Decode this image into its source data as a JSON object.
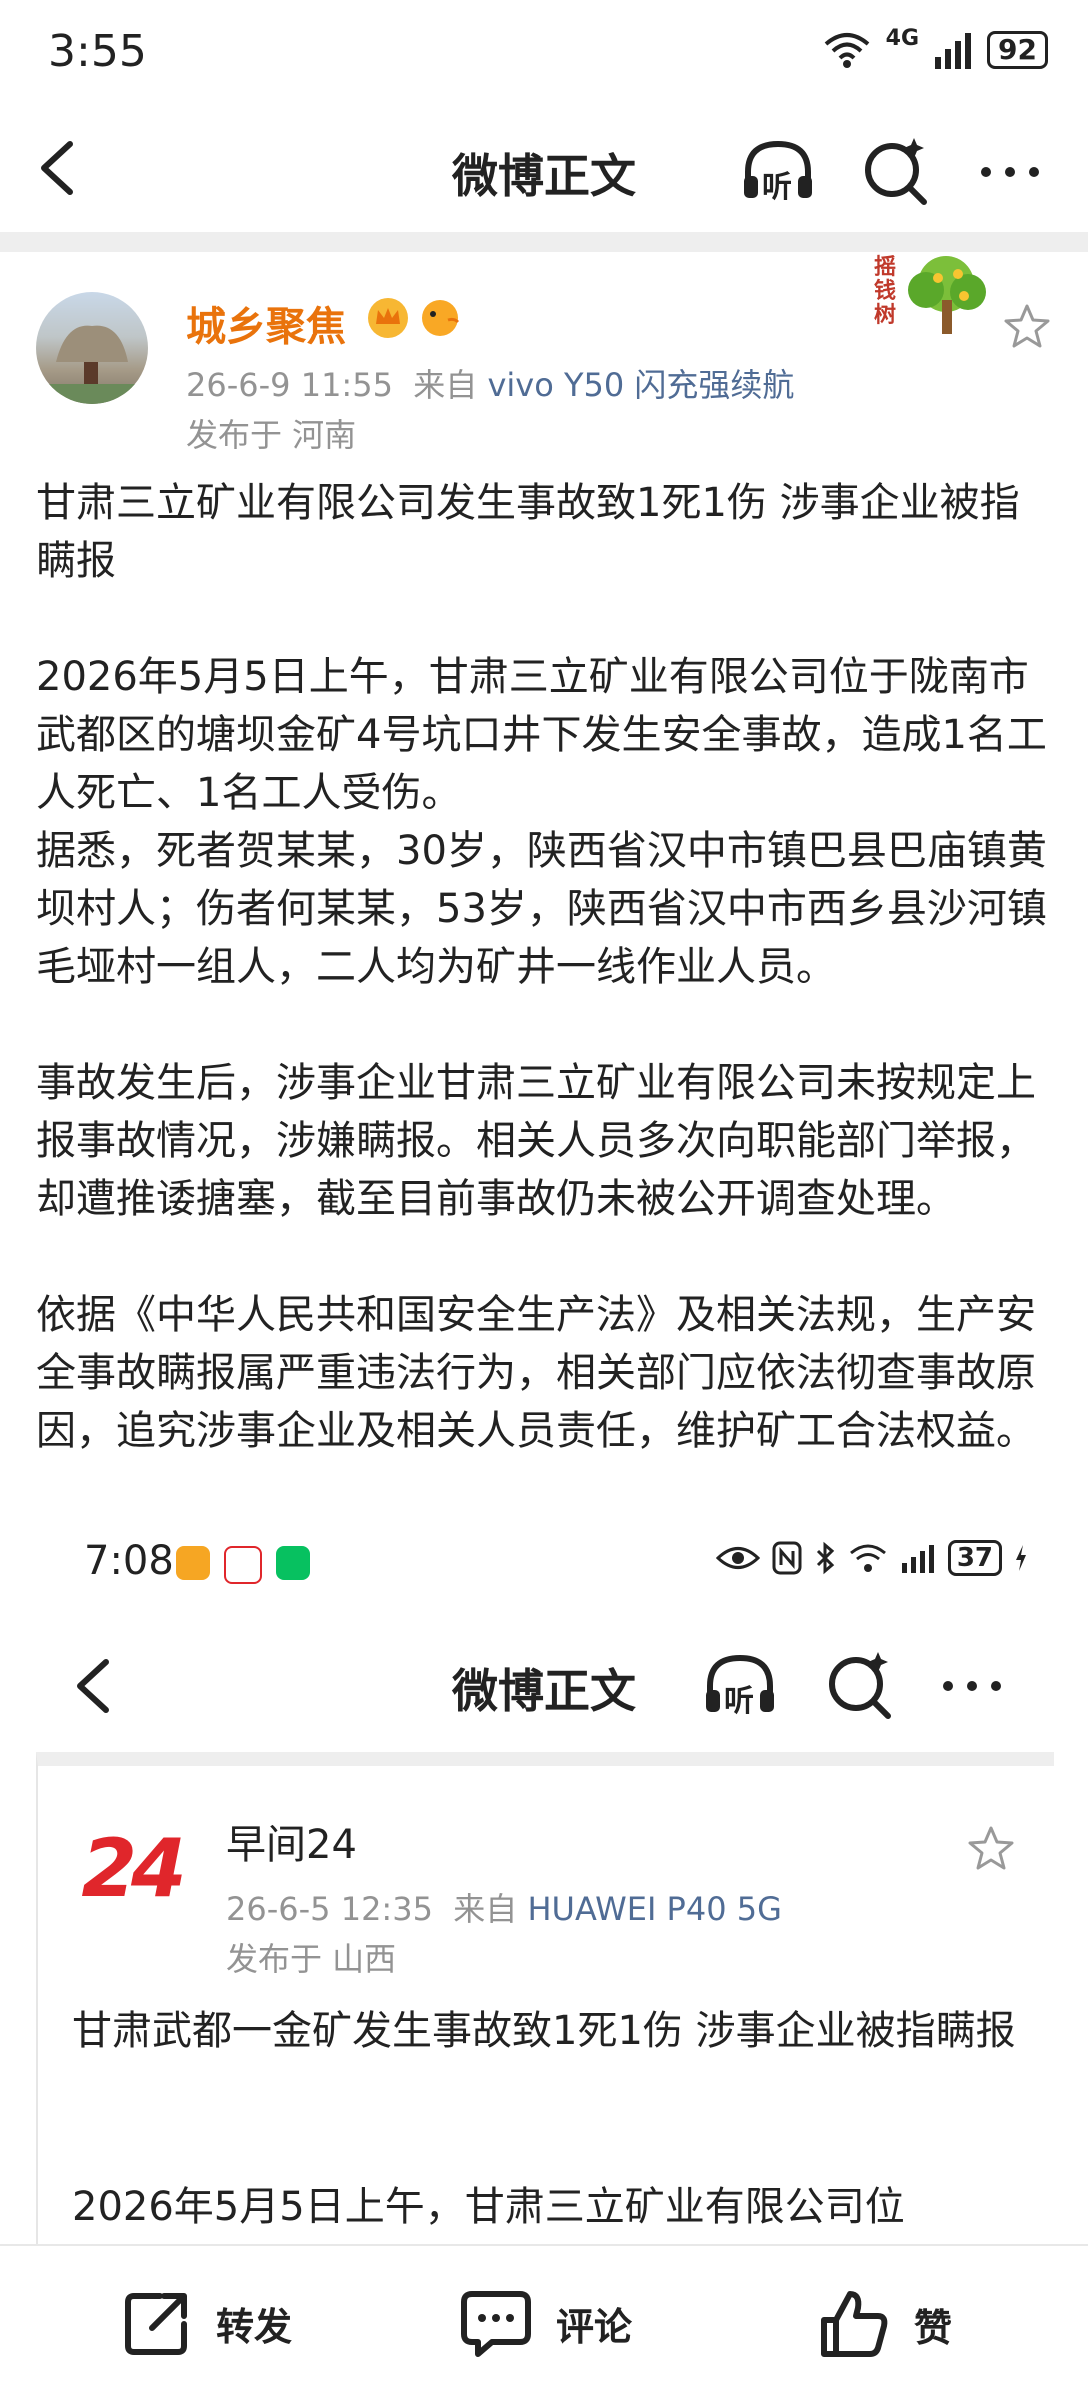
{
  "status_bar": {
    "time": "3:55",
    "network": "4G",
    "battery": "92"
  },
  "header": {
    "title": "微博正文",
    "listen_label": "听"
  },
  "post": {
    "author": "城乡聚焦",
    "date": "26-6-9 11:55",
    "source_prefix": "来自",
    "device": "vivo Y50 闪充强续航",
    "location": "发布于 河南",
    "badge_text": "摇钱树",
    "title": "甘肃三立矿业有限公司发生事故致1死1伤 涉事企业被指瞒报",
    "paragraphs": [
      "2026年5月5日上午，甘肃三立矿业有限公司位于陇南市武都区的塘坝金矿4号坑口井下发生安全事故，造成1名工人死亡、1名工人受伤。",
      "据悉，死者贺某某，30岁，陕西省汉中市镇巴县巴庙镇黄坝村人；伤者何某某，53岁，陕西省汉中市西乡县沙河镇毛垭村一组人，二人均为矿井一线作业人员。",
      "事故发生后，涉事企业甘肃三立矿业有限公司未按规定上报事故情况，涉嫌瞒报。相关人员多次向职能部门举报，却遭推诿搪塞，截至目前事故仍未被公开调查处理。",
      "依据《中华人民共和国安全生产法》及相关法规，生产安全事故瞒报属严重违法行为，相关部门应依法彻查事故原因，追究涉事企业及相关人员责任，维护矿工合法权益。"
    ]
  },
  "embedded": {
    "status_time": "7:08",
    "battery": "37",
    "header_title": "微博正文",
    "listen_label": "听",
    "avatar_text": "24",
    "author": "早间24",
    "date": "26-6-5 12:35",
    "source_prefix": "来自",
    "device": "HUAWEI P40 5G",
    "location": "发布于 山西",
    "title": "甘肃武都一金矿发生事故致1死1伤 涉事企业被指瞒报",
    "first_line": "2026年5月5日上午，甘肃三立矿业有限公司位"
  },
  "bottom_bar": {
    "repost": "转发",
    "comment": "评论",
    "like": "赞"
  },
  "colors": {
    "username": "#e9730c",
    "meta": "#939393",
    "device": "#506c95",
    "embedded_logo": "#e0262b"
  }
}
